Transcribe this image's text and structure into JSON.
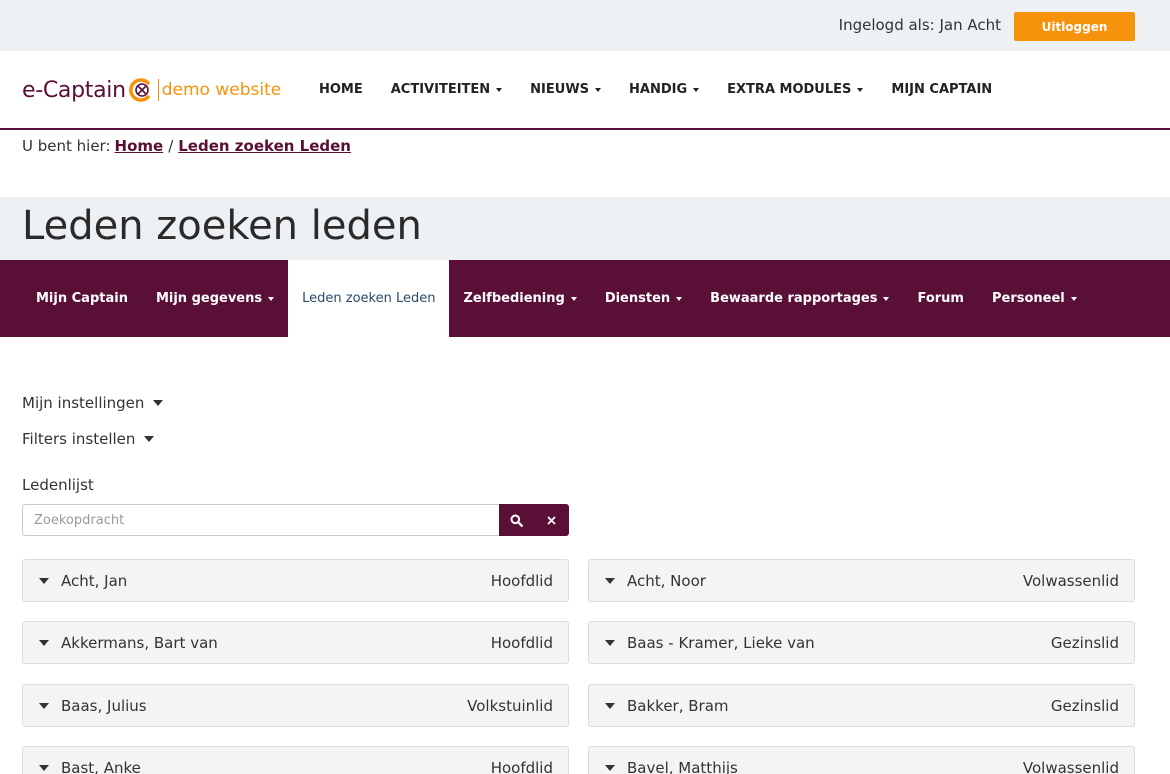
{
  "topbar": {
    "logged_in_text": "Ingelogd als: Jan Acht",
    "logout_label": "Uitloggen"
  },
  "header": {
    "logo_brand": "e-Captain",
    "logo_tagline": "demo website",
    "nav": [
      {
        "label": "HOME"
      },
      {
        "label": "ACTIVITEITEN"
      },
      {
        "label": "NIEUWS"
      },
      {
        "label": "HANDIG"
      },
      {
        "label": "EXTRA MODULES"
      },
      {
        "label": "MIJN CAPTAIN"
      }
    ]
  },
  "breadcrumb": {
    "prefix": "U bent hier:",
    "home": "Home",
    "separator": "/",
    "current": "Leden zoeken Leden"
  },
  "page_title": "Leden zoeken leden",
  "subnav": [
    {
      "label": "Mijn Captain"
    },
    {
      "label": "Mijn gegevens"
    },
    {
      "label": "Leden zoeken Leden"
    },
    {
      "label": "Zelfbediening"
    },
    {
      "label": "Diensten"
    },
    {
      "label": "Bewaarde rapportages"
    },
    {
      "label": "Forum"
    },
    {
      "label": "Personeel"
    }
  ],
  "toggles": {
    "my_settings": "Mijn instellingen",
    "filters": "Filters instellen"
  },
  "list_label": "Ledenlijst",
  "search": {
    "placeholder": "Zoekopdracht",
    "value": ""
  },
  "members": [
    {
      "name": "Acht, Jan",
      "type": "Hoofdlid"
    },
    {
      "name": "Acht, Noor",
      "type": "Volwassenlid"
    },
    {
      "name": "Akkermans, Bart van",
      "type": "Hoofdlid"
    },
    {
      "name": "Baas - Kramer, Lieke van",
      "type": "Gezinslid"
    },
    {
      "name": "Baas, Julius",
      "type": "Volkstuinlid"
    },
    {
      "name": "Bakker, Bram",
      "type": "Gezinslid"
    },
    {
      "name": "Bast, Anke",
      "type": "Hoofdlid"
    },
    {
      "name": "Bavel, Matthijs",
      "type": "Volwassenlid"
    }
  ],
  "colors": {
    "brand_purple": "#5a0f36",
    "accent_orange": "#f7920c",
    "band_grey": "#edf1f4"
  }
}
